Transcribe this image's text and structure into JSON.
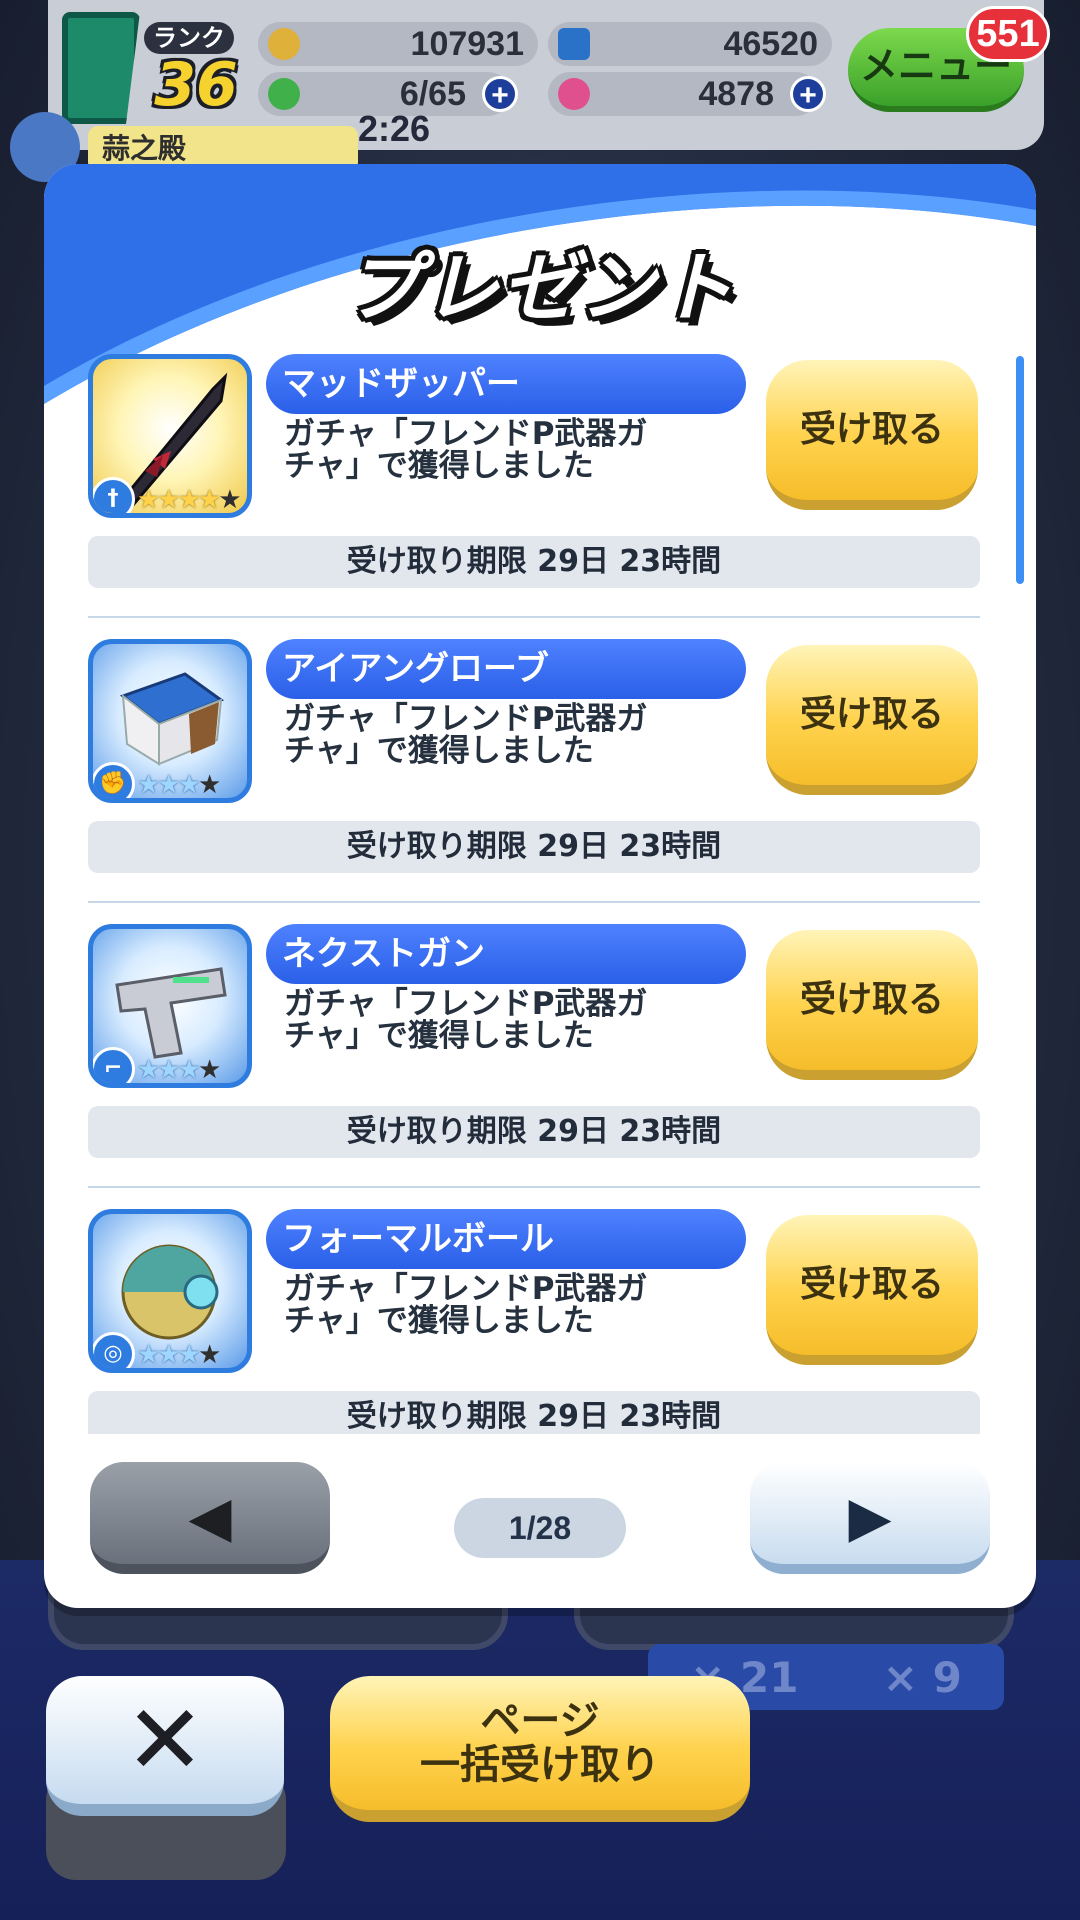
{
  "hud": {
    "rank_label": "ランク",
    "rank_value": "36",
    "coins": "107931",
    "gems": "46520",
    "stamina": "6/65",
    "orbs": "4878",
    "timer": "2:26",
    "menu_label": "メニュー",
    "menu_badge": "551",
    "friend_name": "蒜之殿",
    "plus_symbol": "+"
  },
  "modal": {
    "title": "プレゼント",
    "receive_label": "受け取る",
    "items": [
      {
        "name": "マッドザッパー",
        "desc_line1": "ガチャ「フレンドP武器ガ",
        "desc_line2": "チャ」で獲得しました",
        "deadline": "受け取り期限 29日 23時間",
        "stars_on": "★★★★",
        "stars_off": "★",
        "type_icon": "sword-type-icon",
        "type_glyph": "†",
        "art": "dark-spear"
      },
      {
        "name": "アイアングローブ",
        "desc_line1": "ガチャ「フレンドP武器ガ",
        "desc_line2": "チャ」で獲得しました",
        "deadline": "受け取り期限 29日 23時間",
        "stars_on": "★★★",
        "stars_off": "★",
        "type_icon": "fist-type-icon",
        "type_glyph": "✊",
        "art": "iron-glove"
      },
      {
        "name": "ネクストガン",
        "desc_line1": "ガチャ「フレンドP武器ガ",
        "desc_line2": "チャ」で獲得しました",
        "deadline": "受け取り期限 29日 23時間",
        "stars_on": "★★★",
        "stars_off": "★",
        "type_icon": "gun-type-icon",
        "type_glyph": "⌐",
        "art": "gun"
      },
      {
        "name": "フォーマルボール",
        "desc_line1": "ガチャ「フレンドP武器ガ",
        "desc_line2": "チャ」で獲得しました",
        "deadline": "受け取り期限 29日 23時間",
        "stars_on": "★★★",
        "stars_off": "★",
        "type_icon": "ball-type-icon",
        "type_glyph": "◎",
        "art": "ball"
      }
    ],
    "page_indicator": "1/28",
    "prev_icon": "arrow-left-icon",
    "next_icon": "arrow-right-icon",
    "prev_glyph": "◀",
    "next_glyph": "▶"
  },
  "background": {
    "counter_a": "× 21",
    "counter_b": "× 9"
  },
  "footer": {
    "close_glyph": "✕",
    "bulk_line1": "ページ",
    "bulk_line2": "一括受け取り"
  },
  "colors": {
    "accent_blue": "#2a5fe8",
    "button_yellow": "#ffd24d",
    "modal_header_blue": "#2f6fe8"
  }
}
